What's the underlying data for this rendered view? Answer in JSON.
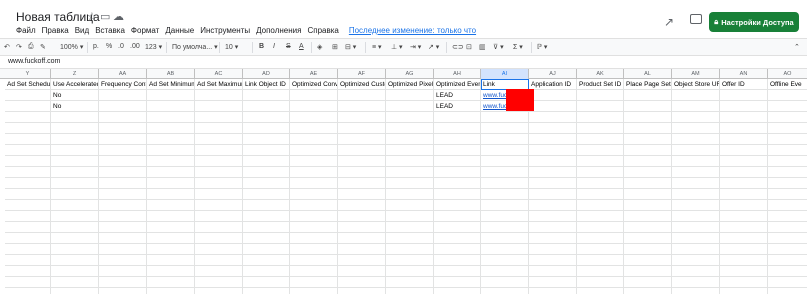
{
  "header": {
    "title": "Новая таблица",
    "menu": [
      "Файл",
      "Правка",
      "Вид",
      "Вставка",
      "Формат",
      "Данные",
      "Инструменты",
      "Дополнения",
      "Справка"
    ],
    "last_edit": "Последнее изменение: только что",
    "share_label": "Настройки Доступа"
  },
  "toolbar": {
    "zoom": "100%",
    "currency": "р.",
    "percent": "%",
    "dec_less": ".0",
    "dec_more": ".00",
    "format_more": "123",
    "font": "По умолча...",
    "font_size": "10",
    "bold": "B",
    "italic": "I",
    "strike": "S",
    "text_color": "A",
    "sigma": "Σ"
  },
  "formula_bar": {
    "value": "www.fuckoff.com"
  },
  "columns": [
    "Y",
    "Z",
    "AA",
    "AB",
    "AC",
    "AD",
    "AE",
    "AF",
    "AG",
    "AH",
    "AI",
    "AJ",
    "AK",
    "AL",
    "AM",
    "AN",
    "AO"
  ],
  "rows": [
    [
      "Ad Set Schedule",
      "Use Accelerated",
      "Frequency Contr",
      "Ad Set Minimum",
      "Ad Set Maximum",
      "Link Object ID",
      "Optimized Conve",
      "Optimized Custo",
      "Optimized Pixel I",
      "Optimized Event",
      "Link",
      "Application ID",
      "Product Set ID",
      "Place Page Set I",
      "Object Store URI",
      "Offer ID",
      "Offline Eve"
    ],
    [
      "",
      "No",
      "",
      "",
      "",
      "",
      "",
      "",
      "",
      "LEAD",
      "www.fuc",
      "",
      "",
      "",
      "",
      "",
      ""
    ],
    [
      "",
      "No",
      "",
      "",
      "",
      "",
      "",
      "",
      "",
      "LEAD",
      "www.fuc",
      "",
      "",
      "",
      "",
      "",
      ""
    ]
  ],
  "colors": {
    "share": "#188038",
    "link": "#1155cc",
    "selection": "#1a73e8",
    "redaction": "#ff0000"
  }
}
